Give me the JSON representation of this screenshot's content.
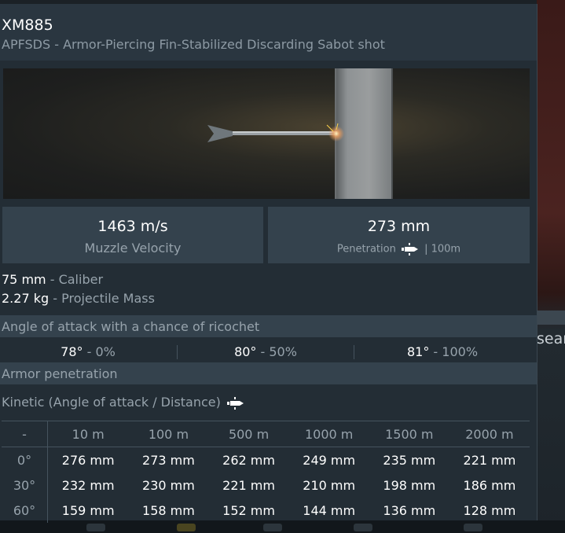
{
  "ammo": {
    "name": "XM885",
    "description": "APFSDS - Armor-Piercing Fin-Stabilized Discarding Sabot shot"
  },
  "stats": {
    "velocity_value": "1463 m/s",
    "velocity_label": "Muzzle Velocity",
    "penetration_value": "273 mm",
    "penetration_label": "Penetration",
    "penetration_range": "| 100m"
  },
  "props": [
    {
      "value": "75 mm",
      "label": "- Caliber"
    },
    {
      "value": "2.27 kg",
      "label": "- Projectile Mass"
    }
  ],
  "ricochet": {
    "title": "Angle of attack with a chance of ricochet",
    "entries": [
      {
        "angle": "78°",
        "chance": "- 0%"
      },
      {
        "angle": "80°",
        "chance": "- 50%"
      },
      {
        "angle": "81°",
        "chance": "- 100%"
      }
    ]
  },
  "armor": {
    "title": "Armor penetration",
    "kinetic_label": "Kinetic (Angle of attack / Distance)",
    "columns": [
      "-",
      "10 m",
      "100 m",
      "500 m",
      "1000 m",
      "1500 m",
      "2000 m"
    ],
    "rows": [
      {
        "angle": "0°",
        "values": [
          "276 mm",
          "273 mm",
          "262 mm",
          "249 mm",
          "235 mm",
          "221 mm"
        ]
      },
      {
        "angle": "30°",
        "values": [
          "232 mm",
          "230 mm",
          "221 mm",
          "210 mm",
          "198 mm",
          "186 mm"
        ]
      },
      {
        "angle": "60°",
        "values": [
          "159 mm",
          "158 mm",
          "152 mm",
          "144 mm",
          "136 mm",
          "128 mm"
        ]
      }
    ]
  },
  "background": {
    "search_text": "searc"
  },
  "icons": [
    "shell-icon"
  ],
  "colors": {
    "panel": "#232d35",
    "header": "#2a3640",
    "box": "#34424d",
    "muted_text": "#97a3ac"
  }
}
